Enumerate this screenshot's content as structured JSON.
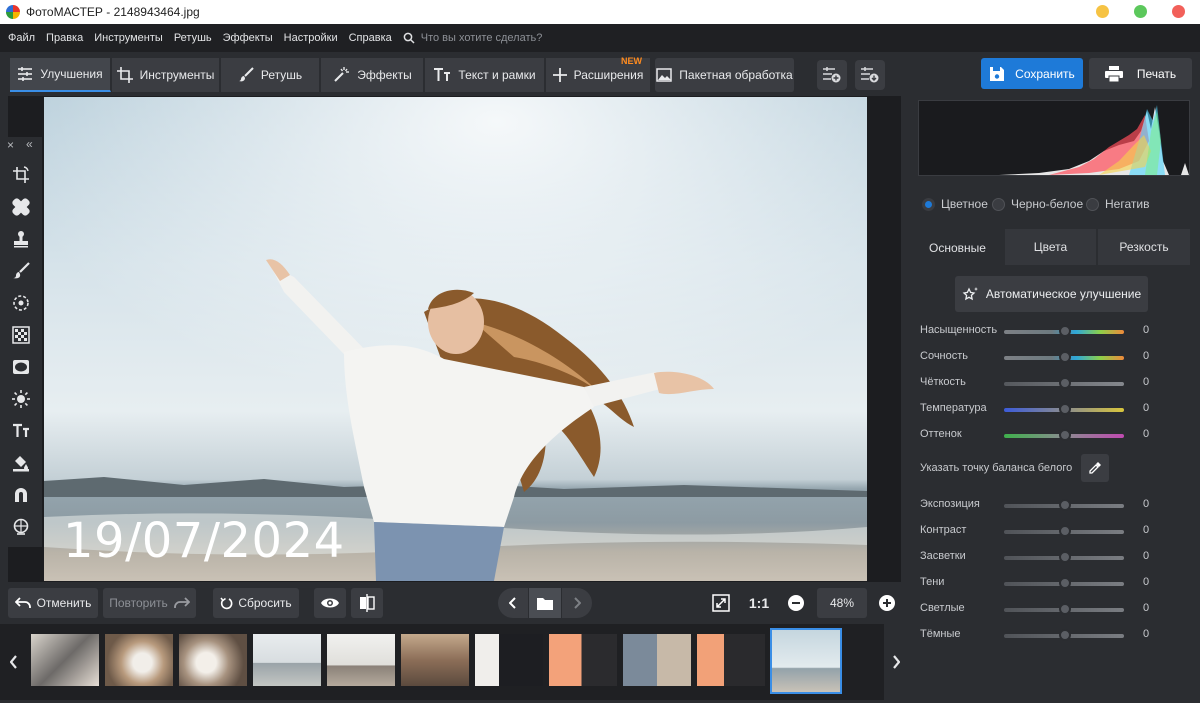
{
  "app": {
    "title": "ФотоМАСТЕР - 2148943464.jpg"
  },
  "window_controls": {
    "colors": [
      "#f6c344",
      "#5cc85c",
      "#f2605a"
    ]
  },
  "menu": {
    "items": [
      "Файл",
      "Правка",
      "Инструменты",
      "Ретушь",
      "Эффекты",
      "Настройки",
      "Справка"
    ],
    "search_placeholder": "Что вы хотите сделать?"
  },
  "tabs": [
    {
      "label": "Улучшения",
      "icon": "sliders-icon",
      "active": true
    },
    {
      "label": "Инструменты",
      "icon": "crop-icon"
    },
    {
      "label": "Ретушь",
      "icon": "brush-icon"
    },
    {
      "label": "Эффекты",
      "icon": "magic-wand-icon"
    },
    {
      "label": "Текст и рамки",
      "icon": "text-icon"
    },
    {
      "label": "Расширения",
      "icon": "plus-icon",
      "badge": "NEW"
    },
    {
      "label": "Пакетная обработка",
      "icon": "gallery-icon"
    }
  ],
  "actions": {
    "save": "Сохранить",
    "print": "Печать"
  },
  "photo": {
    "date_stamp": "19/07/2024"
  },
  "left_tools": [
    "rotate-icon",
    "bandage-icon",
    "stamp-icon",
    "brush-icon",
    "target-icon",
    "grid-icon",
    "vignette-icon",
    "sun-icon",
    "text-icon",
    "fill-icon",
    "magnet-icon",
    "globe-icon"
  ],
  "bottom": {
    "undo": "Отменить",
    "redo": "Повторить",
    "reset": "Сбросить",
    "zoom_1_1": "1:1",
    "zoom_level": "48%"
  },
  "color_modes": [
    {
      "label": "Цветное",
      "selected": true
    },
    {
      "label": "Черно-белое",
      "selected": false
    },
    {
      "label": "Негатив",
      "selected": false
    }
  ],
  "panel_tabs": [
    {
      "label": "Основные",
      "active": true
    },
    {
      "label": "Цвета",
      "active": false
    },
    {
      "label": "Резкость",
      "active": false
    }
  ],
  "auto_button": "Автоматическое улучшение",
  "sliders_top": [
    {
      "label": "Насыщенность",
      "value": "0",
      "gradient": "linear-gradient(90deg,#7d8085,#6d7a80 40%,#2fa7d8 60%,#8cd04a 80%,#f08a3a)"
    },
    {
      "label": "Сочность",
      "value": "0",
      "gradient": "linear-gradient(90deg,#7d8085,#6d7a80 40%,#2fa7d8 60%,#8cd04a 80%,#f08a3a)"
    },
    {
      "label": "Чёткость",
      "value": "0",
      "gradient": "linear-gradient(90deg,#55585d,#85888d)"
    },
    {
      "label": "Температура",
      "value": "0",
      "gradient": "linear-gradient(90deg,#3c5bd9,#8a8c90 50%,#d8c53c)"
    },
    {
      "label": "Оттенок",
      "value": "0",
      "gradient": "linear-gradient(90deg,#3fb04c,#8a8c90 50%,#c04ab0)"
    }
  ],
  "white_balance_label": "Указать точку баланса белого",
  "sliders_bottom": [
    {
      "label": "Экспозиция",
      "value": "0"
    },
    {
      "label": "Контраст",
      "value": "0"
    },
    {
      "label": "Засветки",
      "value": "0"
    },
    {
      "label": "Тени",
      "value": "0"
    },
    {
      "label": "Светлые",
      "value": "0"
    },
    {
      "label": "Тёмные",
      "value": "0"
    }
  ],
  "accent_color": "#1e7ad8"
}
